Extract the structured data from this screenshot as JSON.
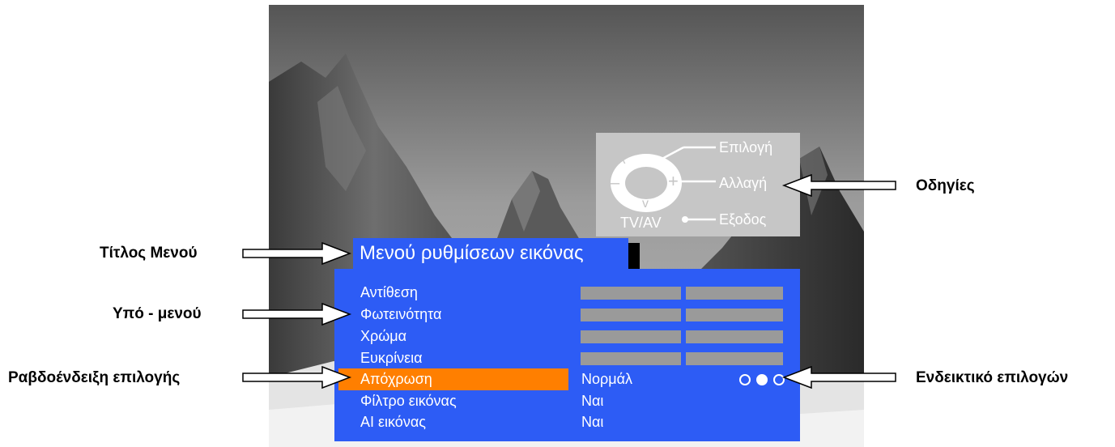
{
  "help": {
    "select_label": "Επιλογή",
    "change_label": "Αλλαγή",
    "exit_label": "Εξοδος",
    "tvav_label": "TV/AV",
    "up_symbol": "^",
    "down_symbol": "v",
    "minus_symbol": "–",
    "plus_symbol": "+"
  },
  "menu": {
    "title": "Μενού ρυθμίσεων εικόνας",
    "items": [
      {
        "label": "Αντίθεση",
        "type": "bar",
        "value": ""
      },
      {
        "label": "Φωτεινότητα",
        "type": "bar",
        "value": ""
      },
      {
        "label": "Χρώμα",
        "type": "bar",
        "value": ""
      },
      {
        "label": "Ευκρίνεια",
        "type": "bar",
        "value": ""
      },
      {
        "label": "Απόχρωση",
        "type": "options",
        "value": "Νορμάλ",
        "selected": true
      },
      {
        "label": "Φίλτρο εικόνας",
        "type": "text",
        "value": "Ναι"
      },
      {
        "label": "AI εικόνας",
        "type": "text",
        "value": "Ναι"
      }
    ],
    "option_dots": [
      false,
      true,
      false
    ]
  },
  "annotations": {
    "menu_title": "Τίτλος Μενού",
    "submenu": "Υπό - μενού",
    "selection_bar": "Ραβδοένδειξη επιλογής",
    "instructions": "Οδηγίες",
    "option_indicator": "Ενδεικτικό επιλογών"
  },
  "colors": {
    "menu_blue": "#2d5cf5",
    "highlight_orange": "#ff7f00",
    "help_gray": "#c6c6c6",
    "bar_gray": "#9a9a9a"
  }
}
